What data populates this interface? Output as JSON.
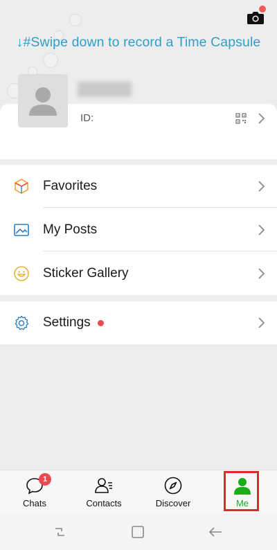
{
  "header": {
    "swipe_hint": "↓#Swipe down to record a Time Capsule",
    "camera_icon": "camera-icon",
    "notification_dot_color": "#f25a5a"
  },
  "profile": {
    "id_label": "ID:",
    "qr_icon": "qr-code-icon"
  },
  "menu_group_1": [
    {
      "label": "Favorites",
      "icon": "cube-icon"
    },
    {
      "label": "My Posts",
      "icon": "image-icon"
    },
    {
      "label": "Sticker Gallery",
      "icon": "smiley-icon"
    }
  ],
  "menu_group_2": [
    {
      "label": "Settings",
      "icon": "gear-icon",
      "has_red_dot": true
    }
  ],
  "bottom_nav": [
    {
      "label": "Chats",
      "icon": "chat-bubble-icon",
      "badge": "1"
    },
    {
      "label": "Contacts",
      "icon": "contacts-icon"
    },
    {
      "label": "Discover",
      "icon": "compass-icon"
    },
    {
      "label": "Me",
      "icon": "person-icon",
      "active": true
    }
  ],
  "colors": {
    "accent_blue": "#2f9fc7",
    "active_green": "#1aad19",
    "badge_red": "#f0484f",
    "highlight_red": "#d92c2c"
  }
}
